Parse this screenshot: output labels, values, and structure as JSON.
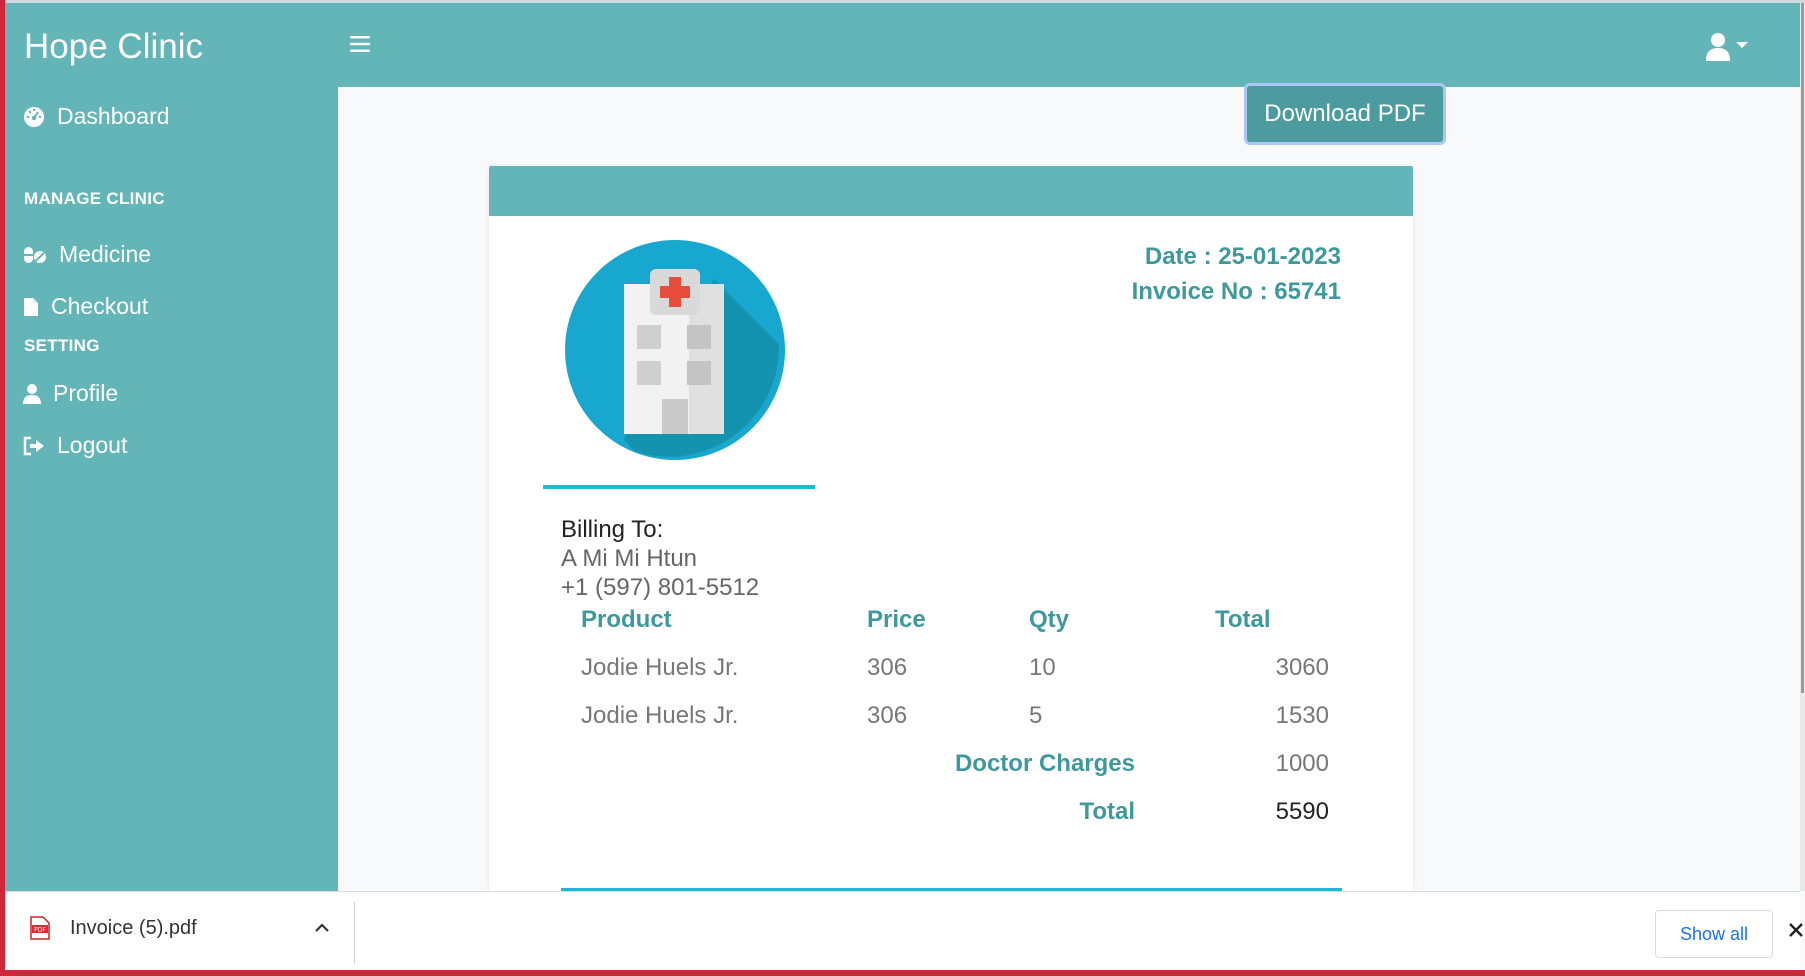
{
  "app": {
    "brand": "Hope Clinic",
    "colors": {
      "primary": "#63b5b8",
      "accent_text": "#3f999b",
      "button": "#4c9c9f",
      "line": "#1eb7d6"
    }
  },
  "topbar": {
    "menu_icon": "hamburger-icon",
    "user_icon": "user-icon"
  },
  "sidebar": {
    "dashboard": "Dashboard",
    "sections": [
      {
        "title": "MANAGE CLINIC"
      },
      {
        "title": "SETTING"
      }
    ],
    "items": [
      {
        "label": "Medicine",
        "icon": "pills-icon"
      },
      {
        "label": "Checkout",
        "icon": "file-icon"
      },
      {
        "label": "Profile",
        "icon": "user-icon"
      },
      {
        "label": "Logout",
        "icon": "logout-icon"
      }
    ]
  },
  "invoice": {
    "download_label": "Download PDF",
    "date": "Date : 25-01-2023",
    "invoice_no": "Invoice No : 65741",
    "billing_label": "Billing To:",
    "customer_name": "A Mi Mi Htun",
    "customer_phone": "+1 (597) 801-5512",
    "columns": [
      "Product",
      "Price",
      "Qty",
      "Total"
    ],
    "rows": [
      {
        "product": "Jodie Huels Jr.",
        "price": "306",
        "qty": "10",
        "total": "3060"
      },
      {
        "product": "Jodie Huels Jr.",
        "price": "306",
        "qty": "5",
        "total": "1530"
      }
    ],
    "doctor_charges_label": "Doctor Charges",
    "doctor_charges": "1000",
    "total_label": "Total",
    "grand_total": "5590"
  },
  "download_bar": {
    "file_name": "Invoice (5).pdf",
    "show_all": "Show all"
  }
}
